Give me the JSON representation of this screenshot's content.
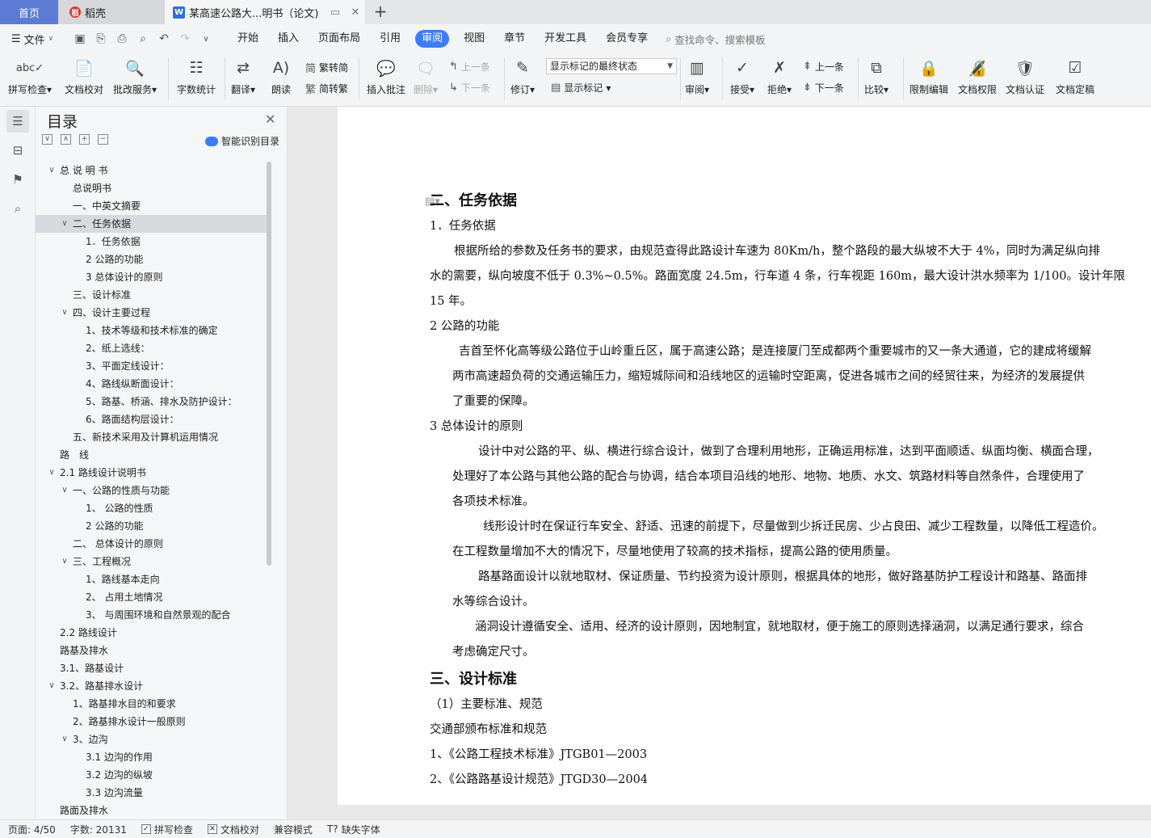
{
  "tabs": {
    "home": "首页",
    "daoke": "稻壳",
    "doc": "某高速公路大...明书（论文)",
    "add": "+"
  },
  "menu": {
    "file": "文件",
    "tabs": [
      "开始",
      "插入",
      "页面布局",
      "引用",
      "审阅",
      "视图",
      "章节",
      "开发工具",
      "会员专享"
    ],
    "active_tab": "审阅",
    "search_placeholder": "查找命令、搜索模板"
  },
  "ribbon": {
    "spell_check": "拼写检查",
    "doc_proof": "文档校对",
    "correction_service": "批改服务",
    "word_count": "字数统计",
    "translate": "翻译",
    "read_aloud": "朗读",
    "trad_to_simp": "繁转简",
    "simp_to_trad": "简转繁",
    "insert_comment": "插入批注",
    "delete": "删除",
    "prev_comment": "上一条",
    "next_comment": "下一条",
    "revise": "修订",
    "markup_state": "显示标记的最终状态",
    "show_markup": "显示标记",
    "review": "审阅",
    "accept": "接受",
    "reject": "拒绝",
    "prev_change": "上一条",
    "next_change": "下一条",
    "compare": "比较",
    "restrict_edit": "限制编辑",
    "doc_permission": "文档权限",
    "doc_certify": "文档认证",
    "doc_finalize": "文档定稿"
  },
  "toc": {
    "title": "目录",
    "smart": "智能识别目录",
    "items": [
      {
        "text": "总 说 明 书",
        "level": 0,
        "chev": "v"
      },
      {
        "text": "总说明书",
        "level": 1
      },
      {
        "text": "一、中英文摘要",
        "level": 1
      },
      {
        "text": "二、任务依据",
        "level": 1,
        "chev": "v",
        "selected": true
      },
      {
        "text": "1．任务依据",
        "level": 2
      },
      {
        "text": "2 公路的功能",
        "level": 2
      },
      {
        "text": "3 总体设计的原则",
        "level": 2
      },
      {
        "text": "三、设计标准",
        "level": 1
      },
      {
        "text": "四、设计主要过程",
        "level": 1,
        "chev": "v"
      },
      {
        "text": "1、技术等级和技术标准的确定",
        "level": 2
      },
      {
        "text": "2、纸上选线：",
        "level": 2
      },
      {
        "text": "3、平面定线设计：",
        "level": 2
      },
      {
        "text": "4、路线纵断面设计：",
        "level": 2
      },
      {
        "text": "5、路基、桥涵、排水及防护设计：",
        "level": 2
      },
      {
        "text": "6、路面结构层设计：",
        "level": 2
      },
      {
        "text": "五、新技术采用及计算机运用情况",
        "level": 1
      },
      {
        "text": "路　线",
        "level": 0
      },
      {
        "text": "2.1 路线设计说明书",
        "level": 0,
        "chev": "v"
      },
      {
        "text": "一、公路的性质与功能",
        "level": 1,
        "chev": "v"
      },
      {
        "text": "1、 公路的性质",
        "level": 2
      },
      {
        "text": "2 公路的功能",
        "level": 2
      },
      {
        "text": "二、 总体设计的原则",
        "level": 1
      },
      {
        "text": "三、工程概况",
        "level": 1,
        "chev": "v"
      },
      {
        "text": "1、路线基本走向",
        "level": 2
      },
      {
        "text": "2、 占用土地情况",
        "level": 2
      },
      {
        "text": "3、 与周围环境和自然景观的配合",
        "level": 2
      },
      {
        "text": "2.2 路线设计",
        "level": 0
      },
      {
        "text": "路基及排水",
        "level": 0
      },
      {
        "text": "3.1、路基设计",
        "level": 0
      },
      {
        "text": "3.2、路基排水设计",
        "level": 0,
        "chev": "v"
      },
      {
        "text": "1、路基排水目的和要求",
        "level": 1
      },
      {
        "text": "2、路基排水设计一般原则",
        "level": 1
      },
      {
        "text": "3、边沟",
        "level": 1,
        "chev": "v"
      },
      {
        "text": "3.1 边沟的作用",
        "level": 2
      },
      {
        "text": "3.2 边沟的纵坡",
        "level": 2
      },
      {
        "text": "3.3 边沟流量",
        "level": 2
      },
      {
        "text": "路面及排水",
        "level": 0
      }
    ]
  },
  "document": {
    "lines": [
      {
        "text": "二、任务依据",
        "heading": true
      },
      {
        "text": "1．任务依据",
        "indent": 0
      },
      {
        "text": "根据所给的参数及任务书的要求，由规范查得此路设计车速为 80Km/h，整个路段的最大纵坡不大于 4%，同时为满足纵向排",
        "indent": 30
      },
      {
        "text": "水的需要，纵向坡度不低于 0.3%~0.5%。路面宽度 24.5m，行车道 4 条，行车视距 160m，最大设计洪水频率为 1/100。设计年限",
        "indent": 0
      },
      {
        "text": "15 年。",
        "indent": 0
      },
      {
        "text": "2 公路的功能",
        "indent": 0
      },
      {
        "text": "吉首至怀化高等级公路位于山岭重丘区，属于高速公路；是连接厦门至成都两个重要城市的又一条大通道，它的建成将缓解",
        "indent": 36
      },
      {
        "text": "两市高速超负荷的交通运输压力，缩短城际间和沿线地区的运输时空距离，促进各城市之间的经贸往来，为经济的发展提供",
        "indent": 28
      },
      {
        "text": "了重要的保障。",
        "indent": 28
      },
      {
        "text": "3 总体设计的原则",
        "indent": 0
      },
      {
        "text": "设计中对公路的平、纵、横进行综合设计，做到了合理利用地形，正确运用标准，达到平面顺适、纵面均衡、横面合理，",
        "indent": 60
      },
      {
        "text": "处理好了本公路与其他公路的配合与协调，结合本项目沿线的地形、地物、地质、水文、筑路材料等自然条件，合理使用了",
        "indent": 28
      },
      {
        "text": "各项技术标准。",
        "indent": 28
      },
      {
        "text": "线形设计时在保证行车安全、舒适、迅速的前提下，尽量做到少拆迁民房、少占良田、减少工程数量，以降低工程造价。",
        "indent": 66
      },
      {
        "text": "在工程数量增加不大的情况下，尽量地使用了较高的技术指标，提高公路的使用质量。",
        "indent": 28
      },
      {
        "text": "路基路面设计以就地取材、保证质量、节约投资为设计原则，根据具体的地形，做好路基防护工程设计和路基、路面排",
        "indent": 60
      },
      {
        "text": "水等综合设计。",
        "indent": 28
      },
      {
        "text": "涵洞设计遵循安全、适用、经济的设计原则，因地制宜，就地取材，便于施工的原则选择涵洞，以满足通行要求，综合",
        "indent": 56
      },
      {
        "text": "考虑确定尺寸。",
        "indent": 28
      },
      {
        "text": "三、设计标准",
        "heading": true
      },
      {
        "text": "（1）主要标准、规范",
        "indent": 0
      },
      {
        "text": "交通部颁布标准和规范",
        "indent": 0
      },
      {
        "text": "1、《公路工程技术标准》JTGB01—2003",
        "indent": 0
      },
      {
        "text": "2、《公路路基设计规范》JTGD30—2004",
        "indent": 0
      }
    ]
  },
  "status": {
    "page": "页面: 4/50",
    "words": "字数: 20131",
    "spell": "拼写检查",
    "proof": "文档校对",
    "compat": "兼容模式",
    "missing_font": "缺失字体"
  }
}
